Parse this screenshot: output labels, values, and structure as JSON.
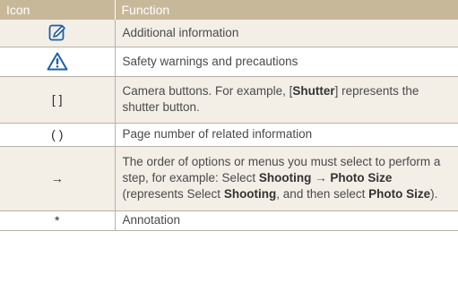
{
  "header": {
    "col_icon": "Icon",
    "col_function": "Function"
  },
  "rows": [
    {
      "icon": "note-pencil-icon",
      "function": "Additional information"
    },
    {
      "icon": "warning-triangle-icon",
      "function": "Safety warnings and precautions"
    },
    {
      "icon_text": "[ ]",
      "function": {
        "p1": "Camera buttons. For example, [",
        "b1": "Shutter",
        "p2": "] represents the shutter button."
      }
    },
    {
      "icon_text": "( )",
      "function": "Page number of related information"
    },
    {
      "icon_text": "→",
      "function": {
        "p1": "The order of options or menus you must select to perform a step, for example: Select ",
        "b1": "Shooting",
        "p2": " → ",
        "b2": "Photo Size",
        "p3": " (represents Select ",
        "b3": "Shooting",
        "p4": ", and then select ",
        "b4": "Photo Size",
        "p5": ")."
      }
    },
    {
      "icon_text": "*",
      "function": "Annotation"
    }
  ],
  "colors": {
    "header_bg": "#c8b89a",
    "shade_bg": "#f3efe7",
    "icon_blue": "#1f5fa8",
    "text": "#4a4a4a",
    "rule": "#b9b2a6"
  }
}
